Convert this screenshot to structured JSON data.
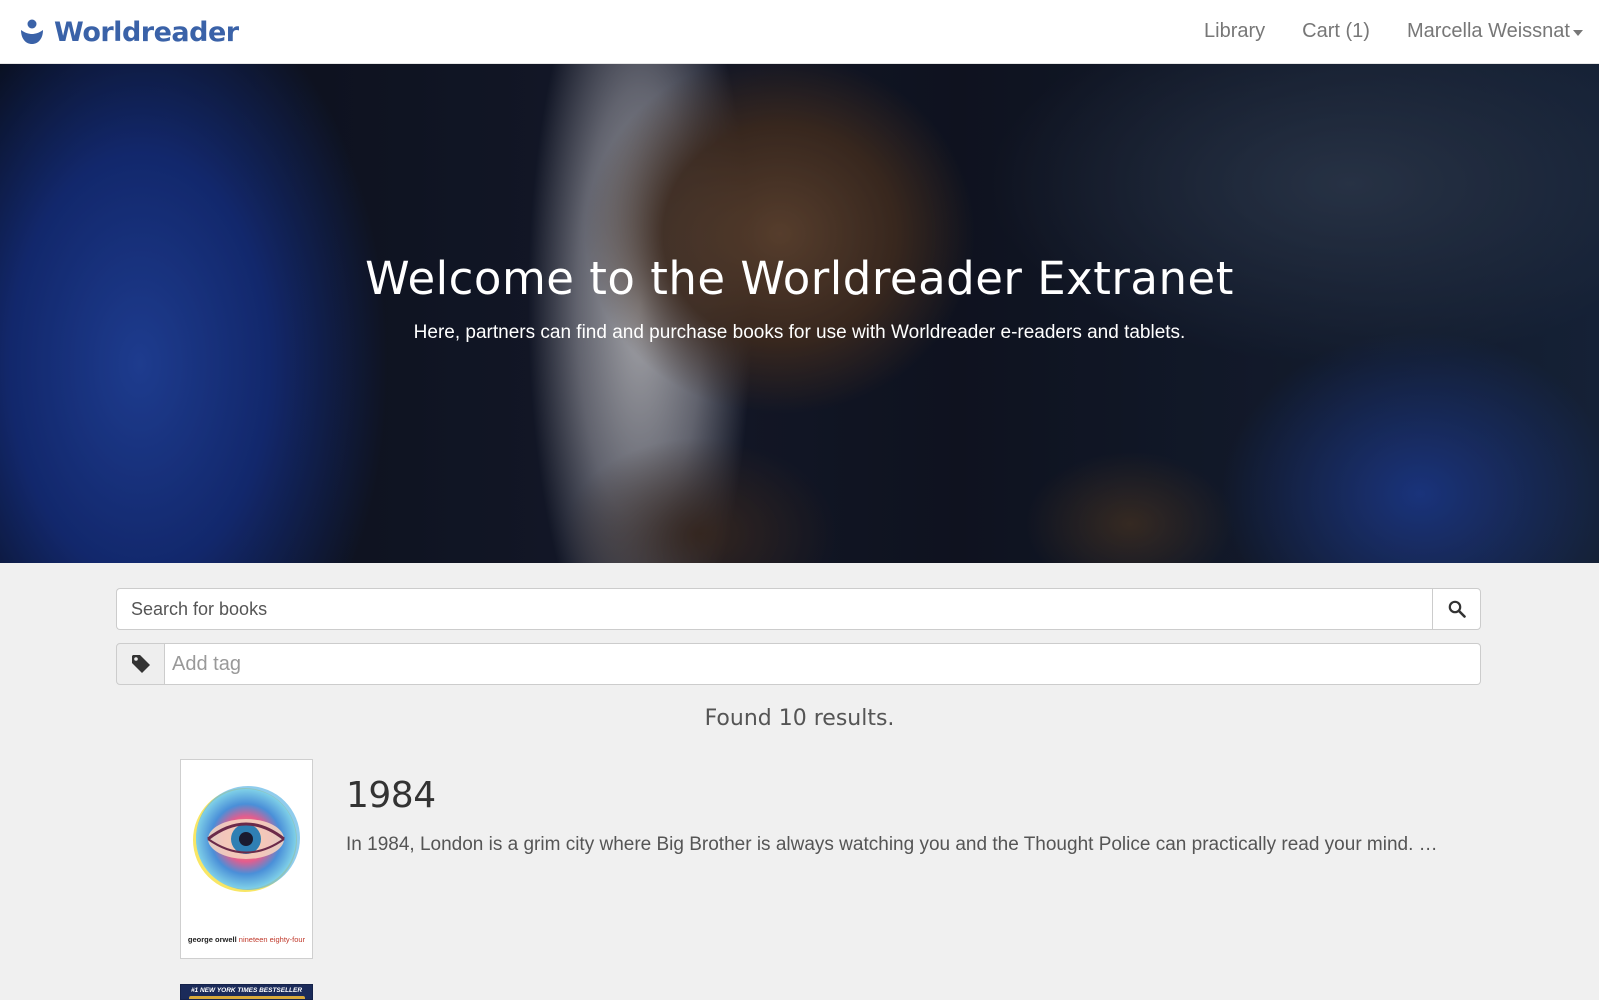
{
  "brand": {
    "name": "Worldreader",
    "color": "#3a62a8"
  },
  "nav": {
    "library": "Library",
    "cart": "Cart (1)",
    "user": "Marcella Weissnat"
  },
  "hero": {
    "title": "Welcome to the Worldreader Extranet",
    "subtitle": "Here, partners can find and purchase books for use with Worldreader e-readers and tablets."
  },
  "search": {
    "placeholder": "Search for books",
    "button_icon": "search-icon"
  },
  "tags": {
    "placeholder": "Add tag",
    "icon": "tag-icon"
  },
  "results": {
    "count_text": "Found 10 results.",
    "books": [
      {
        "title": "1984",
        "description": "In 1984, London is a grim city where Big Brother is always watching you and the Thought Police can practically read your mind. …",
        "cover": {
          "author": "george orwell",
          "title": "nineteen eighty-four"
        }
      },
      {
        "cover": {
          "badge": "#1 NEW YORK TIMES BESTSELLER"
        }
      }
    ]
  }
}
